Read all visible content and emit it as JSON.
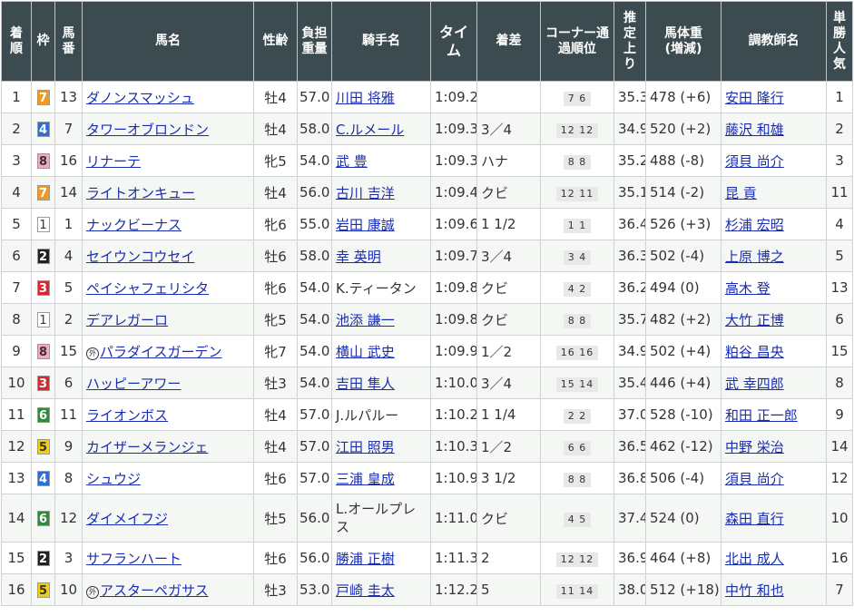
{
  "headers": {
    "rank": "着順",
    "waku": "枠",
    "num": "馬番",
    "horse": "馬名",
    "sexage": "性齢",
    "weight": "負担重量",
    "jockey": "騎手名",
    "time": "タイム",
    "margin": "着差",
    "corner": "コーナー通過順位",
    "last3f": "推定上り",
    "body": "馬体重",
    "body_sub": "(増減)",
    "trainer": "調教師名",
    "pop": "単勝人気"
  },
  "colors": {
    "header_bg": "#3b4b4f",
    "link": "#1a2db0",
    "waku_1": "#ffffff",
    "waku_2": "#222222",
    "waku_3": "#d9262f",
    "waku_4": "#2b6fcf",
    "waku_5": "#f4d000",
    "waku_6": "#2e8b3a",
    "waku_7": "#f39a1e",
    "waku_8": "#f5a8c4"
  },
  "rows": [
    {
      "rank": "1",
      "waku": "7",
      "num": "13",
      "mark": "",
      "horse": "ダノンスマッシュ",
      "sexage": "牡4",
      "weight": "57.0",
      "jockey": "川田 将雅",
      "jockey_link": true,
      "time": "1:09.2",
      "margin": "",
      "corner": "7 6",
      "last3f": "35.3",
      "body": "478 (+6)",
      "trainer": "安田 隆行",
      "pop": "1"
    },
    {
      "rank": "2",
      "waku": "4",
      "num": "7",
      "mark": "",
      "horse": "タワーオブロンドン",
      "sexage": "牡4",
      "weight": "58.0",
      "jockey": "C.ルメール",
      "jockey_link": true,
      "time": "1:09.3",
      "margin": "3／4",
      "corner": "12 12",
      "last3f": "34.9",
      "body": "520 (+2)",
      "trainer": "藤沢 和雄",
      "pop": "2"
    },
    {
      "rank": "3",
      "waku": "8",
      "num": "16",
      "mark": "",
      "horse": "リナーテ",
      "sexage": "牝5",
      "weight": "54.0",
      "jockey": "武 豊",
      "jockey_link": true,
      "time": "1:09.3",
      "margin": "ハナ",
      "corner": "8 8",
      "last3f": "35.2",
      "body": "488 (-8)",
      "trainer": "須貝 尚介",
      "pop": "3"
    },
    {
      "rank": "4",
      "waku": "7",
      "num": "14",
      "mark": "",
      "horse": "ライトオンキュー",
      "sexage": "牡4",
      "weight": "56.0",
      "jockey": "古川 吉洋",
      "jockey_link": true,
      "time": "1:09.4",
      "margin": "クビ",
      "corner": "12 11",
      "last3f": "35.1",
      "body": "514 (-2)",
      "trainer": "昆 貢",
      "pop": "11"
    },
    {
      "rank": "5",
      "waku": "1",
      "num": "1",
      "mark": "",
      "horse": "ナックビーナス",
      "sexage": "牝6",
      "weight": "55.0",
      "jockey": "岩田 康誠",
      "jockey_link": true,
      "time": "1:09.6",
      "margin": "1 1/2",
      "corner": "1 1",
      "last3f": "36.4",
      "body": "526 (+3)",
      "trainer": "杉浦 宏昭",
      "pop": "4"
    },
    {
      "rank": "6",
      "waku": "2",
      "num": "4",
      "mark": "",
      "horse": "セイウンコウセイ",
      "sexage": "牡6",
      "weight": "58.0",
      "jockey": "幸 英明",
      "jockey_link": true,
      "time": "1:09.7",
      "margin": "3／4",
      "corner": "3 4",
      "last3f": "36.3",
      "body": "502 (-4)",
      "trainer": "上原 博之",
      "pop": "5"
    },
    {
      "rank": "7",
      "waku": "3",
      "num": "5",
      "mark": "",
      "horse": "ペイシャフェリシタ",
      "sexage": "牝6",
      "weight": "54.0",
      "jockey": "K.ティータン",
      "jockey_link": false,
      "time": "1:09.8",
      "margin": "クビ",
      "corner": "4 2",
      "last3f": "36.2",
      "body": "494 (0)",
      "trainer": "高木 登",
      "pop": "13"
    },
    {
      "rank": "8",
      "waku": "1",
      "num": "2",
      "mark": "",
      "horse": "デアレガーロ",
      "sexage": "牝5",
      "weight": "54.0",
      "jockey": "池添 謙一",
      "jockey_link": true,
      "time": "1:09.8",
      "margin": "クビ",
      "corner": "8 8",
      "last3f": "35.7",
      "body": "482 (+2)",
      "trainer": "大竹 正博",
      "pop": "6"
    },
    {
      "rank": "9",
      "waku": "8",
      "num": "15",
      "mark": "外",
      "horse": "パラダイスガーデン",
      "sexage": "牝7",
      "weight": "54.0",
      "jockey": "横山 武史",
      "jockey_link": true,
      "time": "1:09.9",
      "margin": "1／2",
      "corner": "16 16",
      "last3f": "34.9",
      "body": "502 (+4)",
      "trainer": "粕谷 昌央",
      "pop": "15"
    },
    {
      "rank": "10",
      "waku": "3",
      "num": "6",
      "mark": "",
      "horse": "ハッピーアワー",
      "sexage": "牡3",
      "weight": "54.0",
      "jockey": "吉田 隼人",
      "jockey_link": true,
      "time": "1:10.0",
      "margin": "3／4",
      "corner": "15 14",
      "last3f": "35.4",
      "body": "446 (+4)",
      "trainer": "武 幸四郎",
      "pop": "8"
    },
    {
      "rank": "11",
      "waku": "6",
      "num": "11",
      "mark": "",
      "horse": "ライオンボス",
      "sexage": "牡4",
      "weight": "57.0",
      "jockey": "J.ルパルー",
      "jockey_link": false,
      "time": "1:10.2",
      "margin": "1 1/4",
      "corner": "2 2",
      "last3f": "37.0",
      "body": "528 (-10)",
      "trainer": "和田 正一郎",
      "pop": "9"
    },
    {
      "rank": "12",
      "waku": "5",
      "num": "9",
      "mark": "",
      "horse": "カイザーメランジェ",
      "sexage": "牡4",
      "weight": "57.0",
      "jockey": "江田 照男",
      "jockey_link": true,
      "time": "1:10.3",
      "margin": "1／2",
      "corner": "6 6",
      "last3f": "36.5",
      "body": "462 (-12)",
      "trainer": "中野 栄治",
      "pop": "14"
    },
    {
      "rank": "13",
      "waku": "4",
      "num": "8",
      "mark": "",
      "horse": "シュウジ",
      "sexage": "牡6",
      "weight": "57.0",
      "jockey": "三浦 皇成",
      "jockey_link": true,
      "time": "1:10.9",
      "margin": "3 1/2",
      "corner": "8 8",
      "last3f": "36.8",
      "body": "506 (-4)",
      "trainer": "須貝 尚介",
      "pop": "12"
    },
    {
      "rank": "14",
      "waku": "6",
      "num": "12",
      "mark": "",
      "horse": "ダイメイフジ",
      "sexage": "牡5",
      "weight": "56.0",
      "jockey": "L.オールプレス",
      "jockey_link": false,
      "time": "1:11.0",
      "margin": "クビ",
      "corner": "4 5",
      "last3f": "37.4",
      "body": "524 (0)",
      "trainer": "森田 直行",
      "pop": "10"
    },
    {
      "rank": "15",
      "waku": "2",
      "num": "3",
      "mark": "",
      "horse": "サフランハート",
      "sexage": "牡6",
      "weight": "56.0",
      "jockey": "勝浦 正樹",
      "jockey_link": true,
      "time": "1:11.3",
      "margin": "2",
      "corner": "12 12",
      "last3f": "36.9",
      "body": "464 (+8)",
      "trainer": "北出 成人",
      "pop": "16"
    },
    {
      "rank": "16",
      "waku": "5",
      "num": "10",
      "mark": "外",
      "horse": "アスターペガサス",
      "sexage": "牡3",
      "weight": "53.0",
      "jockey": "戸崎 圭太",
      "jockey_link": true,
      "time": "1:12.2",
      "margin": "5",
      "corner": "11 14",
      "last3f": "38.0",
      "body": "512 (+18)",
      "trainer": "中竹 和也",
      "pop": "7"
    }
  ]
}
